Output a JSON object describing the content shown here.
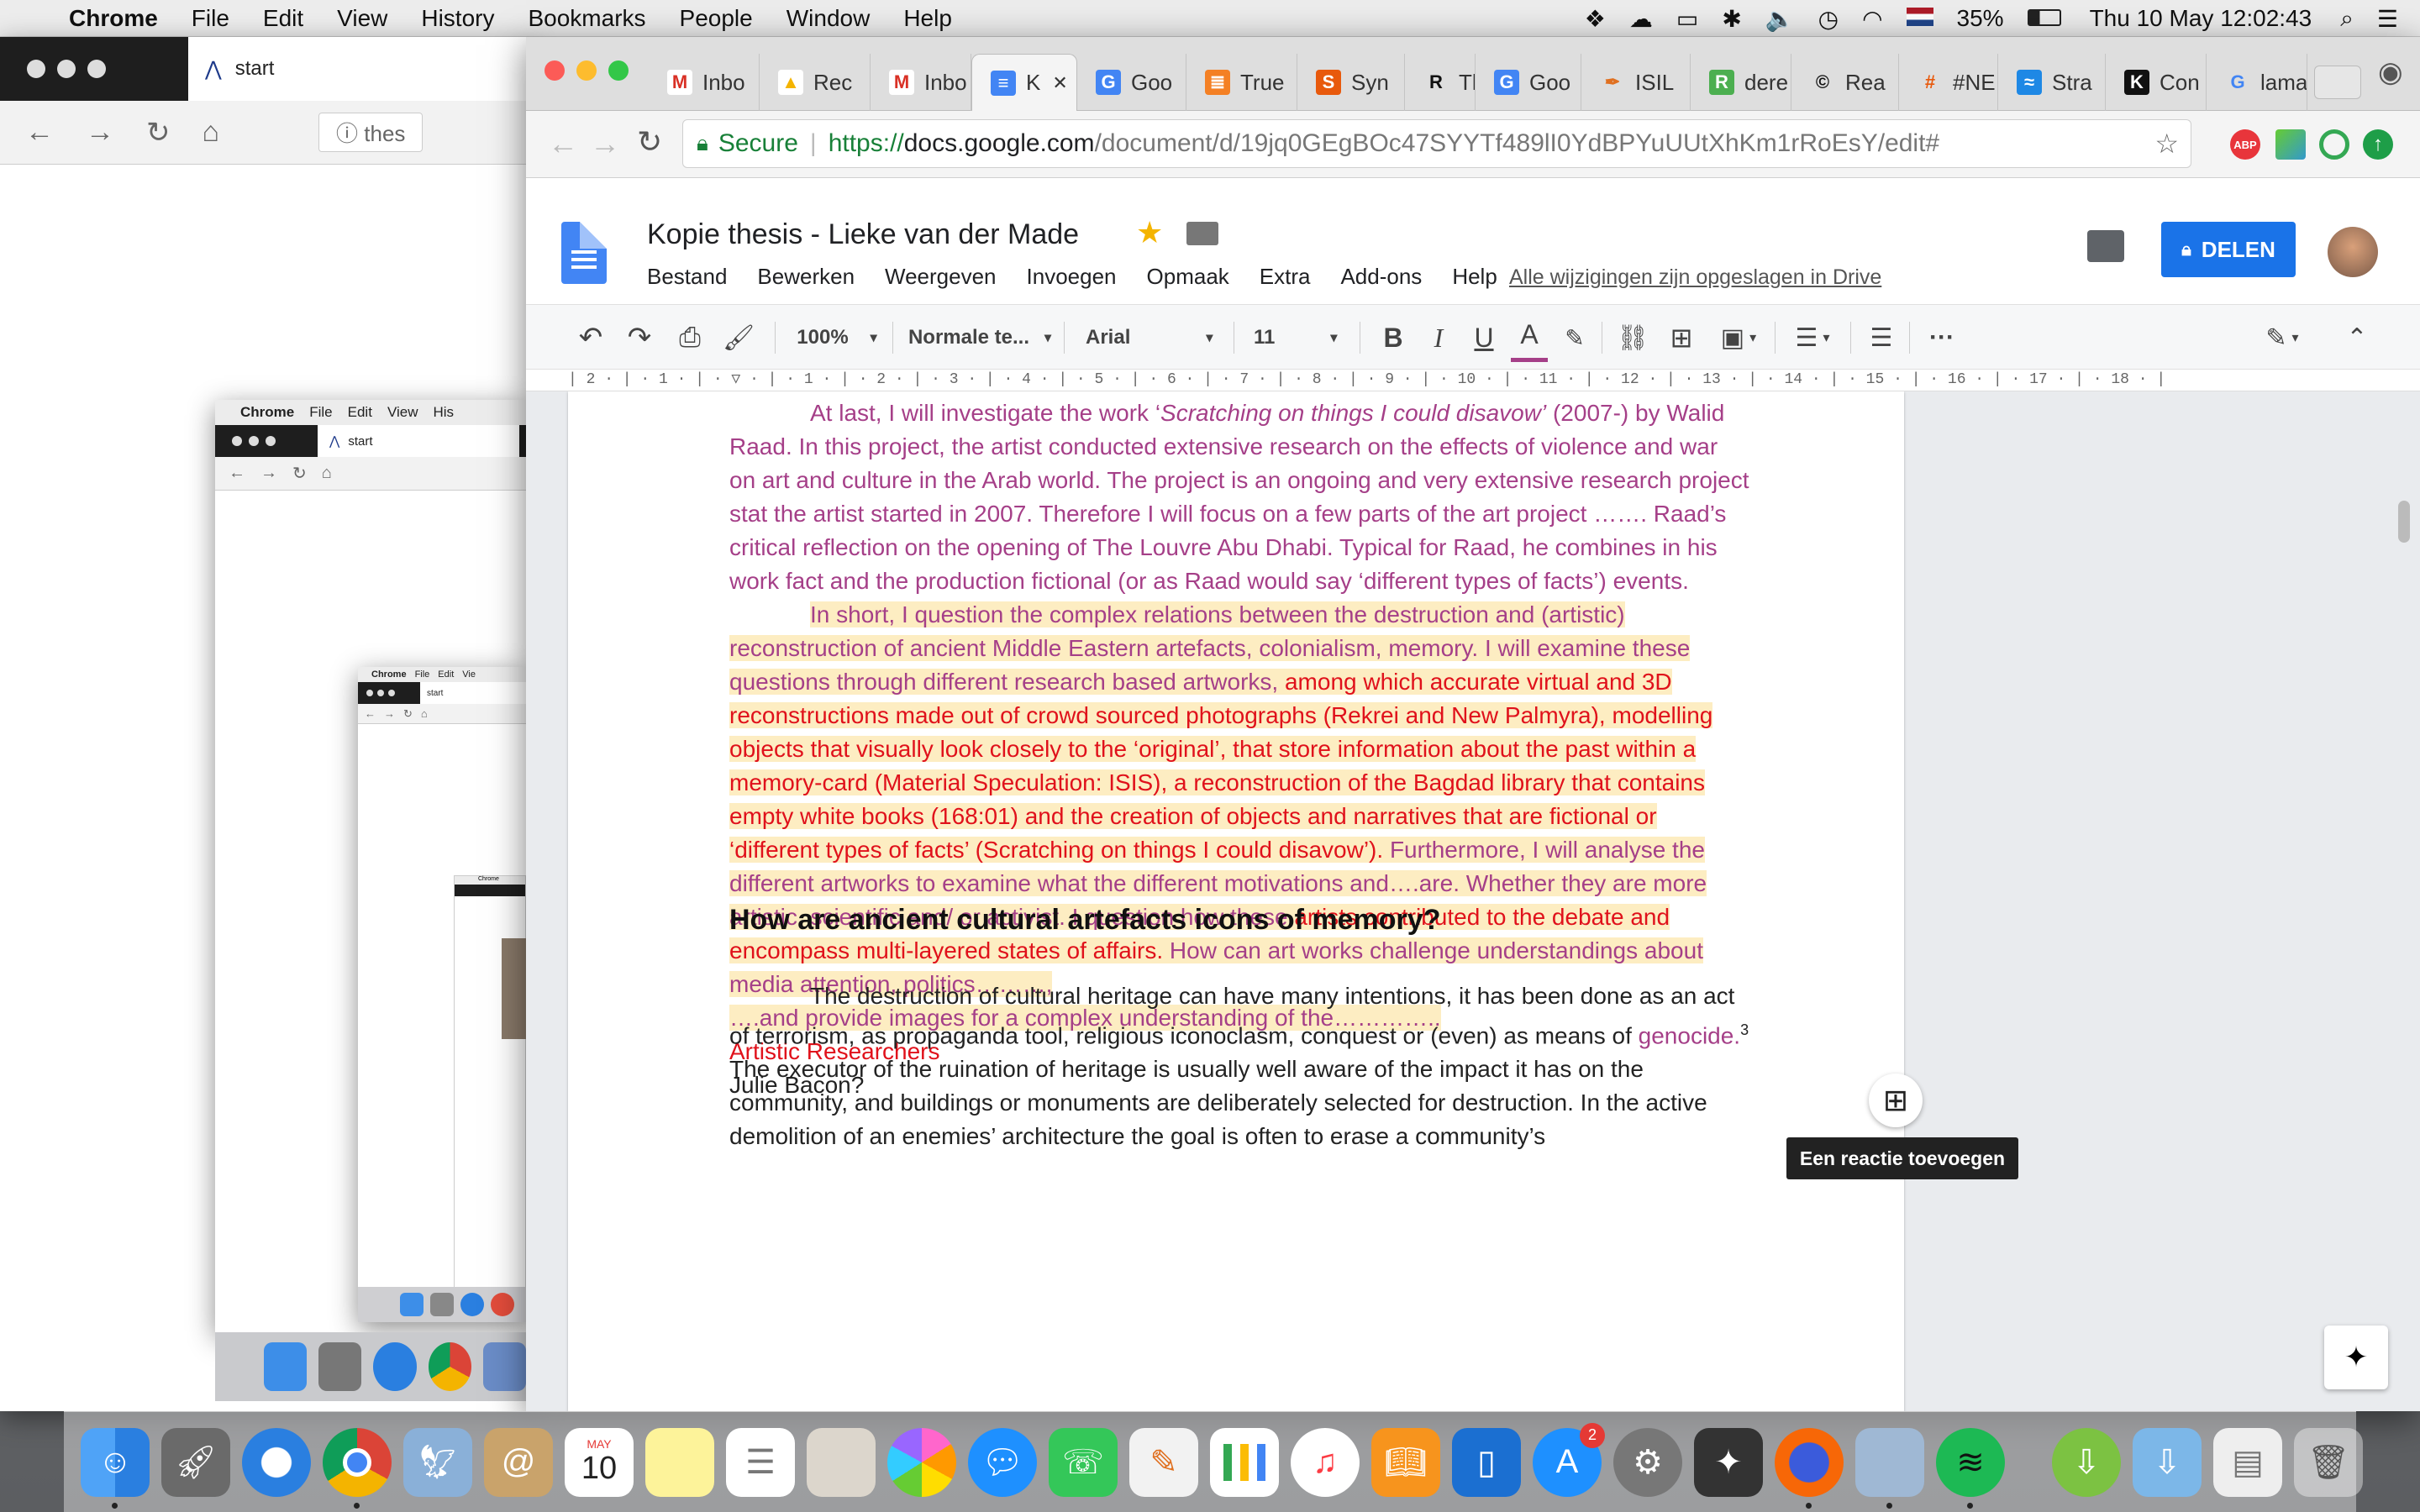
{
  "menubar": {
    "app": "Chrome",
    "items": [
      "File",
      "Edit",
      "View",
      "History",
      "Bookmarks",
      "People",
      "Window",
      "Help"
    ],
    "battery": "35%",
    "datetime": "Thu 10 May  12:02:43"
  },
  "bg_window": {
    "tab_label": "start",
    "url_partial": "thes"
  },
  "bg_window_small": {
    "app": "Chrome",
    "items": [
      "File",
      "Edit",
      "View",
      "His"
    ],
    "tab_label": "start"
  },
  "bg_window_tiny": {
    "app": "Chrome",
    "items": [
      "File",
      "Edit",
      "Vie"
    ],
    "tab_label": "start"
  },
  "bg_window_micro": {
    "app": "Chrome"
  },
  "tabs": [
    {
      "label": "Inbo",
      "icon": "gmail-icon"
    },
    {
      "label": "Rec",
      "icon": "drive-icon"
    },
    {
      "label": "Inbo",
      "icon": "gmail-icon"
    },
    {
      "label": "K",
      "icon": "docs-icon",
      "active": true
    },
    {
      "label": "Goo",
      "icon": "translate-icon"
    },
    {
      "label": "True",
      "icon": "stack-icon"
    },
    {
      "label": "Syn",
      "icon": "s-icon"
    },
    {
      "label": "The",
      "icon": "r-icon"
    },
    {
      "label": "Goo",
      "icon": "translate-icon"
    },
    {
      "label": "ISIL",
      "icon": "pen-icon"
    },
    {
      "label": "dere",
      "icon": "r-green-icon"
    },
    {
      "label": "Rea",
      "icon": "cc-icon"
    },
    {
      "label": "#NE",
      "icon": "hash-icon"
    },
    {
      "label": "Stra",
      "icon": "wave-icon"
    },
    {
      "label": "Con",
      "icon": "k-icon"
    },
    {
      "label": "lama",
      "icon": "google-icon"
    }
  ],
  "address": {
    "secure": "Secure",
    "scheme": "https://",
    "host": "docs.google.com",
    "path": "/document/d/19jq0GEgBOc47SYYTf489lI0YdBPYuUUtXhKm1rRoEsY/edit#"
  },
  "extensions": [
    "ABP"
  ],
  "doc": {
    "title": "Kopie thesis - Lieke van der Made",
    "menus": [
      "Bestand",
      "Bewerken",
      "Weergeven",
      "Invoegen",
      "Opmaak",
      "Extra",
      "Add-ons",
      "Help"
    ],
    "saved": "Alle wijzigingen zijn opgeslagen in Drive",
    "share": "DELEN"
  },
  "toolbar": {
    "zoom": "100%",
    "style": "Normale te...",
    "font": "Arial",
    "size": "11",
    "bold": "B",
    "italic": "I",
    "underline": "U",
    "color": "A"
  },
  "ruler": "| 2 · | · 1 · | · ▽ · | · 1 · | · 2 · | · 3 · | · 4 · | · 5 · | · 6 · | · 7 · | · 8 · | · 9 · | · 10 · | · 11 · | · 12 · | · 13 · | · 14 · | · 15 · | · 16 · | · 17 · | · 18 · |",
  "content": {
    "p1": {
      "a": "At last, I will investigate the work ‘",
      "b": "Scratching on things I could disavow’",
      "c": " (2007-) by Walid Raad. In this project, the artist conducted extensive research on the effects of violence and war on art and culture in the Arab world. The project is an ongoing and very extensive research project stat the artist started in 2007. Therefore I will focus on a few parts of the art project ……. Raad’s critical reflection on the opening of The Louvre Abu Dhabi. Typical for Raad, he combines in his work fact and the production fictional (or as Raad would say ‘different types of facts’) events."
    },
    "p2": {
      "a": "In short, I question the complex relations between the destruction and (artistic) reconstruction of ancient Middle Eastern artefacts, colonialism, memory. I will examine these questions through different research based artworks, ",
      "b": "among which accurate virtual and 3D reconstructions made out of crowd sourced photographs (Rekrei and New Palmyra), modelling objects that visually look closely to the ‘original’, that store information about the past within a memory-card (Material Speculation: ISIS), a reconstruction of the Bagdad library that contains empty white books (168:01) and the creation of objects and narratives that are fictional or ‘different types of facts’ (Scratching on things I could disavow’).",
      "c": " Furthermore, I will analyse the different artworks to examine what the different motivations and….are. Whether they are more artistic, scientific and/ or activist. I question how these ",
      "d": "artists contributed to the debate and encompass multi-layered states of affairs.",
      "e": " How can art works challenge understandings about media attention, politics………,",
      "f": "….and provide images for a complex understanding of the…………..",
      "g": "Artistic Researchers",
      "h": "Julie Bacon?"
    },
    "heading": "How are ancient cultural artefacts icons of memory?",
    "p3": {
      "a": "The destruction of cultural heritage can have many intentions, it has been done as an act of terrorism, as propaganda tool, religious iconoclasm, conquest or (even) as means of ",
      "b": "genocide.",
      "sup": "3",
      "c": " The executor of the ruination of heritage is usually well aware of the impact it has on the community, and buildings or monuments are deliberately selected for destruction. In the active demolition of an enemies’ architecture the goal is often to erase a community’s"
    },
    "tooltip": "Een reactie toevoegen"
  },
  "dock": {
    "calendar_month": "MAY",
    "calendar_day": "10",
    "appstore_badge": "2"
  },
  "colors": {
    "accent": "#1a73e8",
    "mauve": "#a53f88",
    "red": "#e0111b",
    "highlight": "#fdedc2"
  }
}
